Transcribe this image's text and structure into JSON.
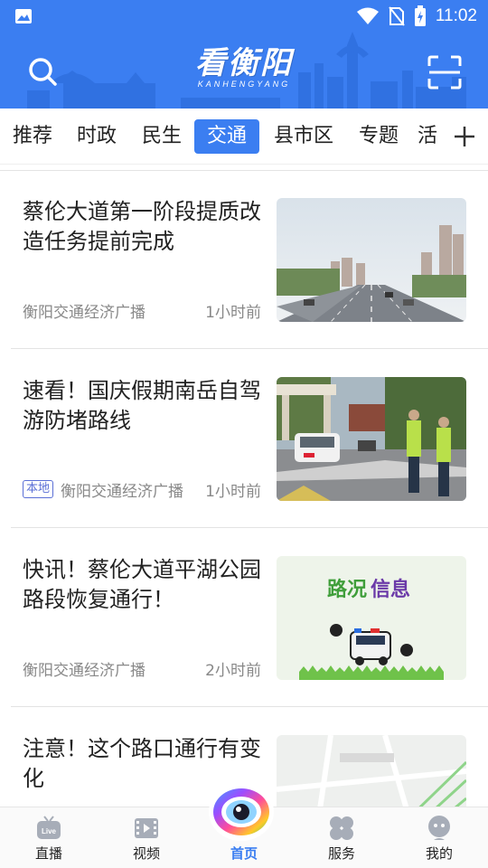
{
  "status_bar": {
    "time": "11:02"
  },
  "header": {
    "logo_text": "看衡阳",
    "logo_subtext": "KANHENGYANG",
    "search_icon": "search-icon",
    "scan_icon": "scan-icon",
    "accent_color": "#3b7ef1"
  },
  "tabs": {
    "items": [
      {
        "label": "推荐"
      },
      {
        "label": "时政"
      },
      {
        "label": "民生"
      },
      {
        "label": "交通",
        "active": true
      },
      {
        "label": "县市区"
      },
      {
        "label": "专题"
      },
      {
        "label": "活"
      }
    ],
    "add_icon": "plus-icon"
  },
  "articles": [
    {
      "title": "蔡伦大道第一阶段提质改造任务提前完成",
      "source": "衡阳交通经济广播",
      "time": "1小时前",
      "tag": ""
    },
    {
      "title": "速看！国庆假期南岳自驾游防堵路线",
      "source": "衡阳交通经济广播",
      "time": "1小时前",
      "tag": "本地"
    },
    {
      "title": "快讯！蔡伦大道平湖公园路段恢复通行！",
      "source": "衡阳交通经济广播",
      "time": "2小时前",
      "tag": "",
      "thumb_text": {
        "part1": "路况",
        "part2": "信息"
      }
    },
    {
      "title": "注意！这个路口通行有变化",
      "source": "",
      "time": "",
      "tag": ""
    }
  ],
  "bottom_nav": {
    "items": [
      {
        "label": "直播",
        "icon": "live-tv-icon"
      },
      {
        "label": "视频",
        "icon": "video-icon"
      },
      {
        "label": "首页",
        "icon": "eye-logo-icon",
        "active": true
      },
      {
        "label": "服务",
        "icon": "services-grid-icon"
      },
      {
        "label": "我的",
        "icon": "profile-icon"
      }
    ],
    "live_badge": "Live"
  }
}
